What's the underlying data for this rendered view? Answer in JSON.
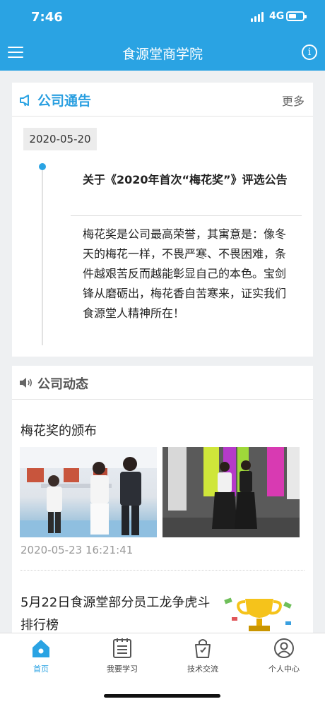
{
  "status": {
    "time": "7:46",
    "network": "4G",
    "battery_level": 0.55
  },
  "header": {
    "title": "食源堂商学院"
  },
  "notice": {
    "section_title": "公司通告",
    "more_label": "更多",
    "date": "2020-05-20",
    "headline": "关于《2020年首次“梅花奖”》评选公告",
    "body": "梅花奖是公司最高荣誉，其寓意是：像冬天的梅花一样，不畏严寒、不畏困难，条件越艰苦反而越能彰显自己的本色。宝剑锋从磨砺出，梅花香自苦寒来，证实我们食源堂人精神所在！"
  },
  "news": {
    "section_title": "公司动态",
    "items": [
      {
        "title": "梅花奖的颁布",
        "time": "2020-05-23 16:21:41"
      },
      {
        "title": "5月22日食源堂部分员工龙争虎斗排行榜"
      }
    ]
  },
  "tabs": [
    {
      "label": "首页",
      "icon": "home-icon",
      "active": true
    },
    {
      "label": "我要学习",
      "icon": "notebook-icon",
      "active": false
    },
    {
      "label": "技术交流",
      "icon": "bag-icon",
      "active": false
    },
    {
      "label": "个人中心",
      "icon": "user-icon",
      "active": false
    }
  ],
  "colors": {
    "accent": "#2aa3e3",
    "background": "#eef0f2"
  }
}
